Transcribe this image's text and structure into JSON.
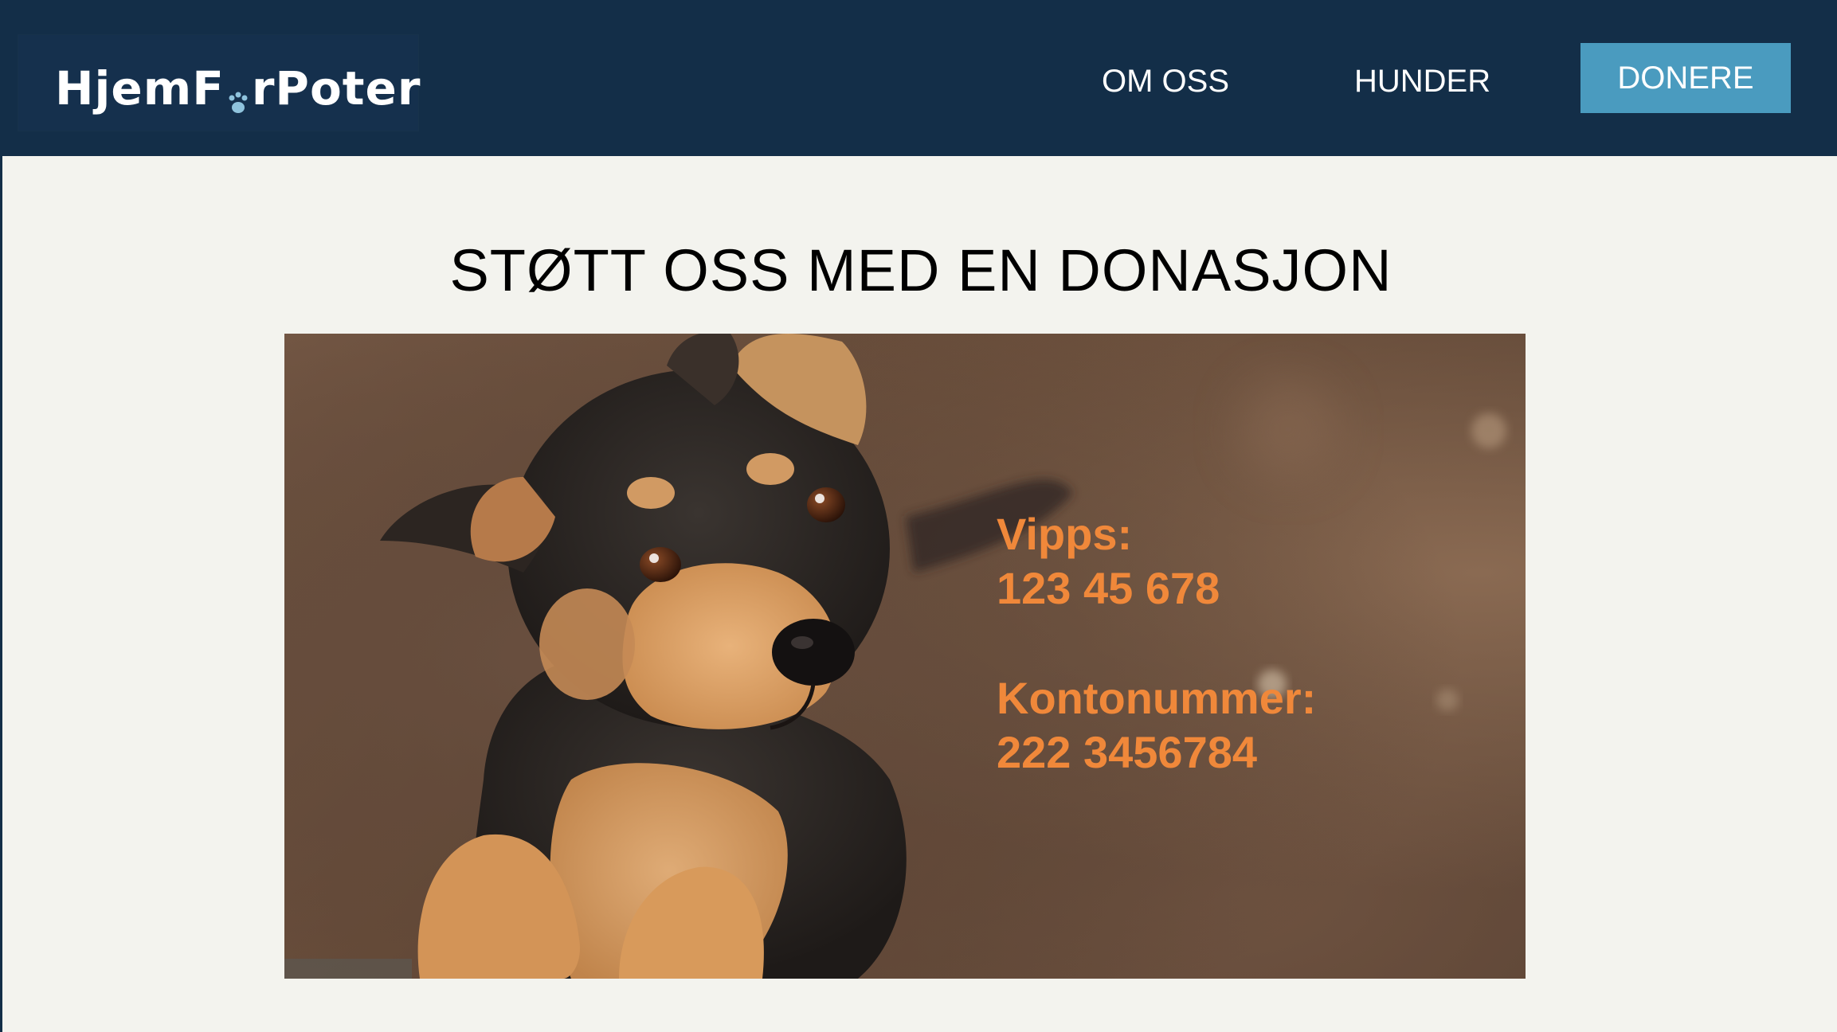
{
  "header": {
    "logo_text_a": "HjemF",
    "logo_text_b": "rPoter",
    "nav": {
      "om_oss": "OM OSS",
      "hunder": "HUNDER",
      "donere": "DONERE"
    }
  },
  "main": {
    "title": "STØTT OSS MED EN DONASJON",
    "vipps_label": "Vipps:",
    "vipps_number": "123 45 678",
    "konto_label": "Kontonummer:",
    "konto_number": "222 3456784"
  },
  "colors": {
    "header_bg": "#132e48",
    "accent_button": "#4a9bbf",
    "payment_text": "#f0883a",
    "page_bg": "#f3f3ee"
  },
  "icons": {
    "logo_o": "paw-icon"
  }
}
